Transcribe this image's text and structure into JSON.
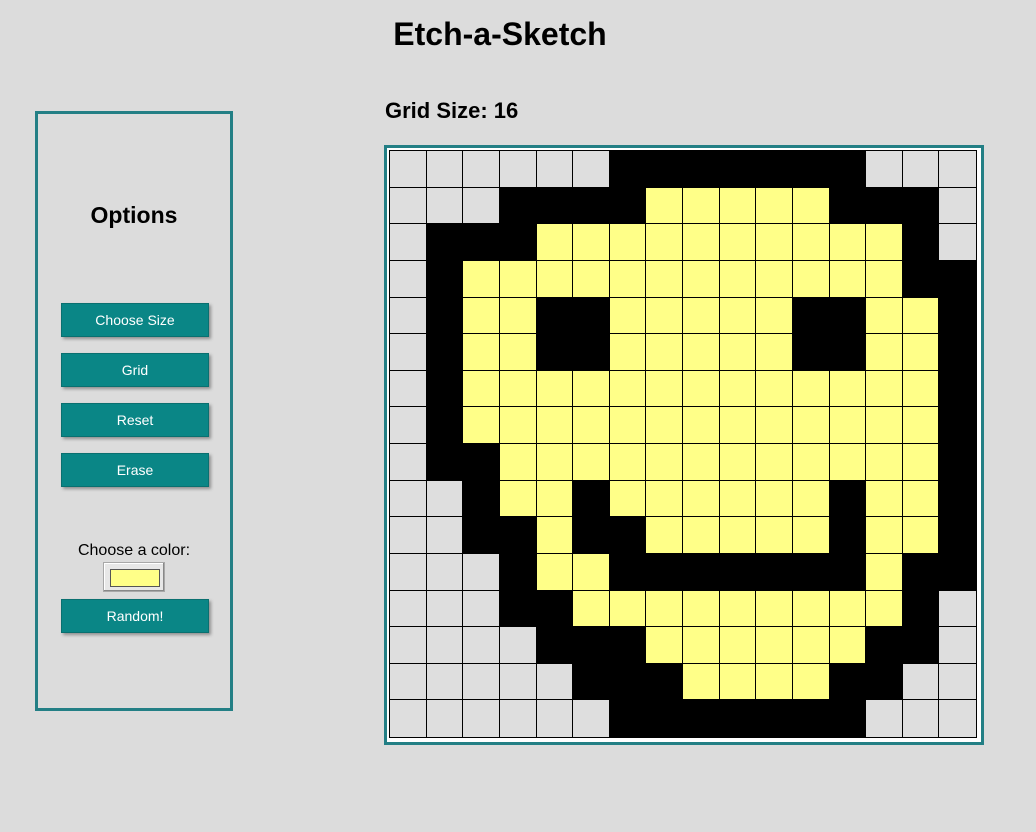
{
  "app": {
    "title": "Etch-a-Sketch"
  },
  "options": {
    "heading": "Options",
    "buttons": {
      "choose_size": "Choose Size",
      "grid": "Grid",
      "reset": "Reset",
      "erase": "Erase",
      "random": "Random!"
    },
    "color_label": "Choose a color:",
    "selected_color": "#ffff88"
  },
  "canvas": {
    "grid_size_label": "Grid Size: 16",
    "size": 16,
    "palette": {
      "E": "#dedede",
      "B": "#000000",
      "Y": "#ffff88"
    },
    "rows": [
      "EEEEEEBBBBBBBEEE",
      "EEEBBBBYYYYYBBBE",
      "EBBBYYYYYYYYYYBE",
      "EBYYYYYYYYYYYYBB",
      "EBYYBBYYYYYBBYYB",
      "EBYYBBYYYYYBBYYB",
      "EBYYYYYYYYYYYYYB",
      "EBYYYYYYYYYYYYYB",
      "EBBYYYYYYYYYYYYB",
      "EEBYYBYYYYYYBYYB",
      "EEBBYBBYYYYYBYYB",
      "EEEBYYBBBBBBBYBB",
      "EEEBBYYYYYYYYYBE",
      "EEEEBBBYYYYYYBBE",
      "EEEEEBBBYYYYBBEE",
      "EEEEEEBBBBBBBEEE"
    ]
  }
}
